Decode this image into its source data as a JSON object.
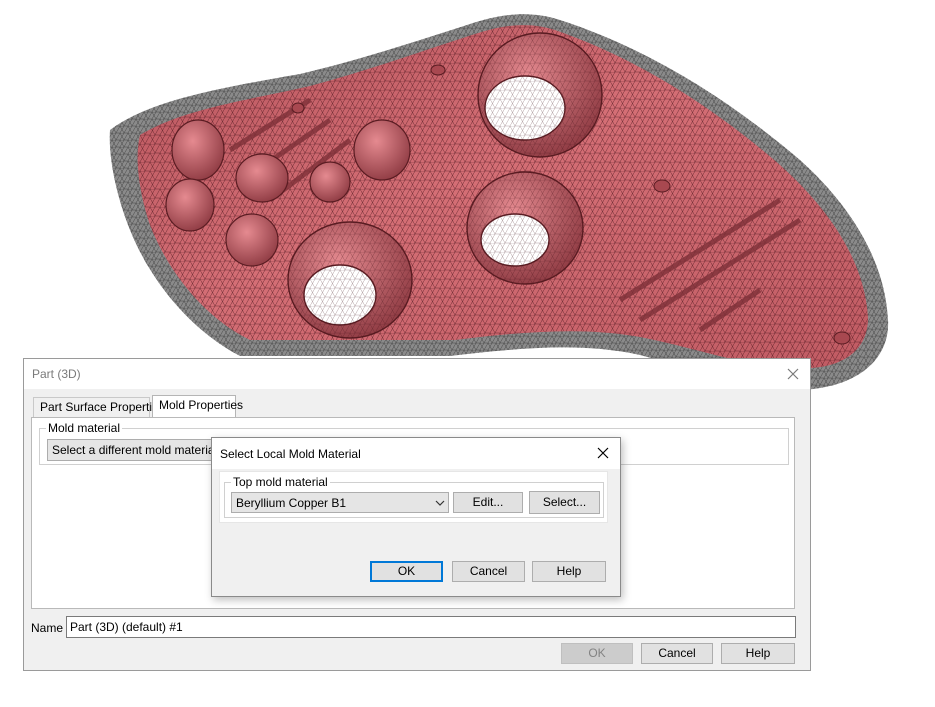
{
  "part_dialog": {
    "title": "Part (3D)",
    "tabs": [
      {
        "label": "Part Surface Properties"
      },
      {
        "label": "Mold Properties"
      }
    ],
    "mold_group_label": "Mold material",
    "mold_select_label": "Select a different mold material",
    "name_label": "Name",
    "name_value": "Part (3D) (default) #1",
    "ok_label": "OK",
    "cancel_label": "Cancel",
    "help_label": "Help"
  },
  "local_dialog": {
    "title": "Select Local Mold Material",
    "group_label": "Top mold material",
    "material_selected": "Beryllium Copper B1",
    "edit_label": "Edit...",
    "select_label": "Select...",
    "ok_label": "OK",
    "cancel_label": "Cancel",
    "help_label": "Help"
  },
  "colors": {
    "part_fill": "#c9626a",
    "part_shadow": "#7e3038",
    "mesh_line": "#3a0c14",
    "outer_edge": "#6e6e6e",
    "focus_accent": "#0078d7"
  },
  "icons": {
    "close": "close-icon",
    "dropdown": "chevron-down-icon"
  }
}
